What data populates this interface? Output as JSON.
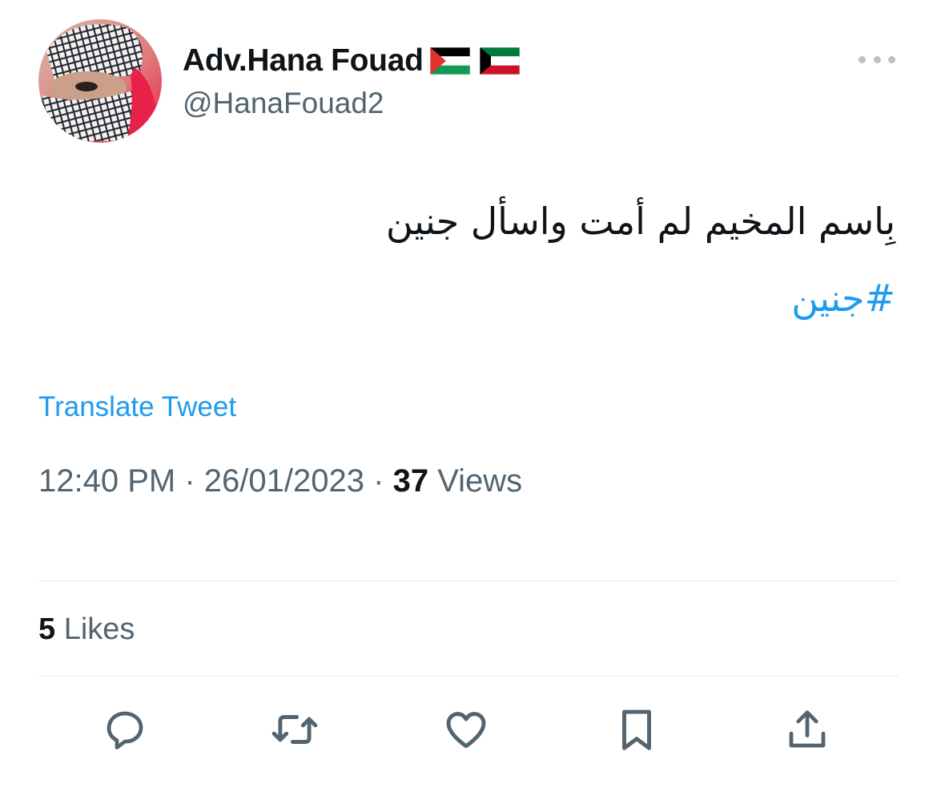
{
  "author": {
    "display_name": "Adv.Hana Fouad",
    "handle": "@HanaFouad2",
    "flags": [
      "palestine-flag",
      "kuwait-flag"
    ]
  },
  "tweet": {
    "text": "بِاسم المخيم لم أمت واسأل جنين",
    "hashtag": "#جنين",
    "translate_label": "Translate Tweet",
    "time": "12:40 PM",
    "separator": "·",
    "date": "26/01/2023",
    "views_count": "37",
    "views_label": "Views"
  },
  "stats": {
    "likes_count": "5",
    "likes_label": "Likes"
  },
  "actions": [
    {
      "name": "reply",
      "icon": "reply-icon"
    },
    {
      "name": "retweet",
      "icon": "retweet-icon"
    },
    {
      "name": "like",
      "icon": "heart-icon"
    },
    {
      "name": "bookmark",
      "icon": "bookmark-icon"
    },
    {
      "name": "share",
      "icon": "share-icon"
    }
  ],
  "colors": {
    "link": "#1d9bf0",
    "text": "#0f1419",
    "secondary": "#536471",
    "divider": "#e4e8eb"
  }
}
